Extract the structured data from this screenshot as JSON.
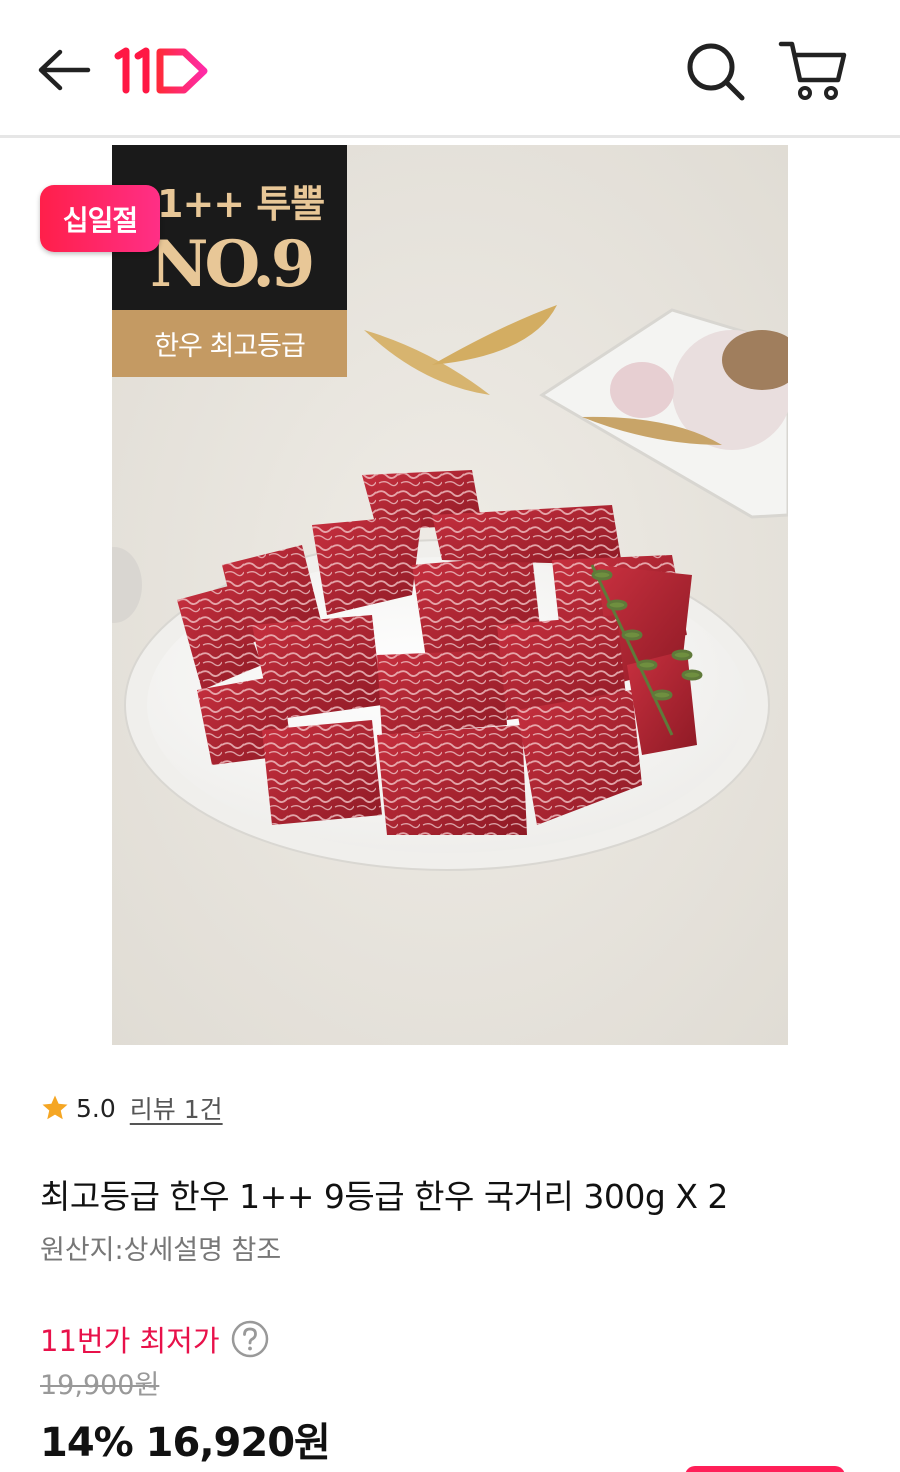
{
  "header": {
    "logo_text": "11",
    "icons": {
      "back": "arrow-left-icon",
      "search": "search-icon",
      "cart": "cart-icon"
    }
  },
  "image_overlay": {
    "sale_badge": "십일절",
    "grade_line1": "1++ 투뿔",
    "grade_line2": "NO.9",
    "grade_caption": "한우 최고등급"
  },
  "rating": {
    "score": "5.0",
    "review_link": "리뷰 1건"
  },
  "product": {
    "title": "최고등급 한우 1++ 9등급 한우 국거리 300g X 2",
    "origin": "원산지:상세설명 참조"
  },
  "price": {
    "lowest_label": "11번가 최저가",
    "original": "19,900원",
    "discount": "14%",
    "sale_price": "16,920",
    "sale_unit": "원"
  },
  "colors": {
    "brand": "#ff0038",
    "price_label": "#e8114a",
    "grade_gold": "#c49a63"
  }
}
